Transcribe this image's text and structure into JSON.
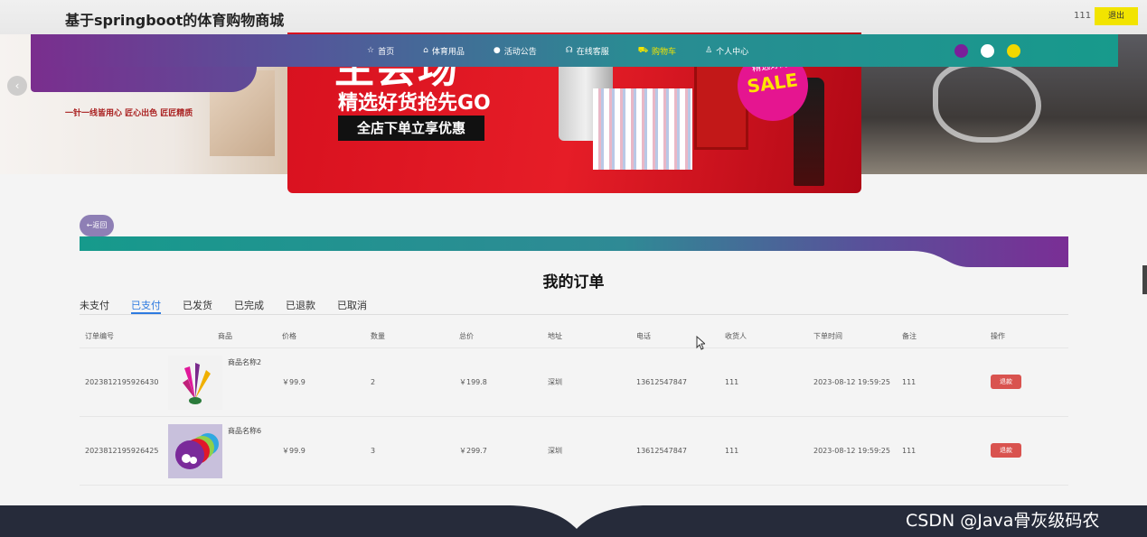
{
  "header": {
    "title": "基于springboot的体育购物商城",
    "user": "111",
    "logout": "退出"
  },
  "nav": {
    "items": [
      {
        "icon": "☆",
        "label": "首页"
      },
      {
        "icon": "⌂",
        "label": "体育用品"
      },
      {
        "icon": "●",
        "label": "活动公告"
      },
      {
        "icon": "☊",
        "label": "在线客服"
      },
      {
        "icon": "⛟",
        "label": "购物车",
        "active": true
      },
      {
        "icon": "♙",
        "label": "个人中心"
      }
    ],
    "theme_colors": [
      "#7a1f9a",
      "#ffffff",
      "#f1d800"
    ]
  },
  "banner": {
    "main_title": "主会场",
    "subtitle": "精选好货抢先GO",
    "tagline": "全店下单立享优惠",
    "badge_top": "精选好商",
    "badge_sale": "SALE",
    "left_slogan": "一针一线皆用心 匠心出色 匠匠精质"
  },
  "back_button": "←返回",
  "page_title": "我的订单",
  "tabs": [
    "未支付",
    "已支付",
    "已发货",
    "已完成",
    "已退款",
    "已取消"
  ],
  "active_tab": "已支付",
  "table": {
    "headers": [
      "订单编号",
      "商品",
      "价格",
      "数量",
      "总价",
      "地址",
      "电话",
      "收货人",
      "下单时间",
      "备注",
      "操作"
    ],
    "rows": [
      {
        "order_no": "2023812195926430",
        "goods_name": "商品名称2",
        "price": "￥99.9",
        "qty": "2",
        "total": "￥199.8",
        "address": "深圳",
        "phone": "13612547847",
        "receiver": "111",
        "time": "2023-08-12 19:59:25",
        "remark": "111",
        "action": "退款"
      },
      {
        "order_no": "2023812195926425",
        "goods_name": "商品名称6",
        "price": "￥99.9",
        "qty": "3",
        "total": "￥299.7",
        "address": "深圳",
        "phone": "13612547847",
        "receiver": "111",
        "time": "2023-08-12 19:59:25",
        "remark": "111",
        "action": "退款"
      }
    ]
  },
  "watermark": "CSDN @Java骨灰级码农"
}
